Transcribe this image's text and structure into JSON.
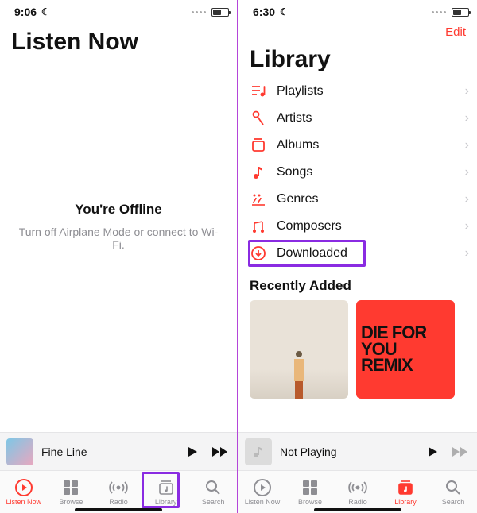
{
  "left": {
    "status": {
      "time": "9:06"
    },
    "title": "Listen Now",
    "offline": {
      "heading": "You're Offline",
      "sub": "Turn off Airplane Mode or connect to Wi-Fi."
    },
    "nowplaying": {
      "title": "Fine Line"
    },
    "tabs": [
      "Listen Now",
      "Browse",
      "Radio",
      "Library",
      "Search"
    ],
    "active_tab": 0,
    "highlight_tab_index": 3
  },
  "right": {
    "status": {
      "time": "6:30"
    },
    "edit_label": "Edit",
    "title": "Library",
    "items": [
      {
        "icon": "playlists",
        "label": "Playlists"
      },
      {
        "icon": "artists",
        "label": "Artists"
      },
      {
        "icon": "albums",
        "label": "Albums"
      },
      {
        "icon": "songs",
        "label": "Songs"
      },
      {
        "icon": "genres",
        "label": "Genres"
      },
      {
        "icon": "composers",
        "label": "Composers"
      },
      {
        "icon": "downloaded",
        "label": "Downloaded"
      }
    ],
    "highlight_item_index": 6,
    "recently_title": "Recently Added",
    "album2_text": "DIE FOR YOU REMIX",
    "nowplaying": {
      "title": "Not Playing"
    },
    "tabs": [
      "Listen Now",
      "Browse",
      "Radio",
      "Library",
      "Search"
    ],
    "active_tab": 3
  }
}
